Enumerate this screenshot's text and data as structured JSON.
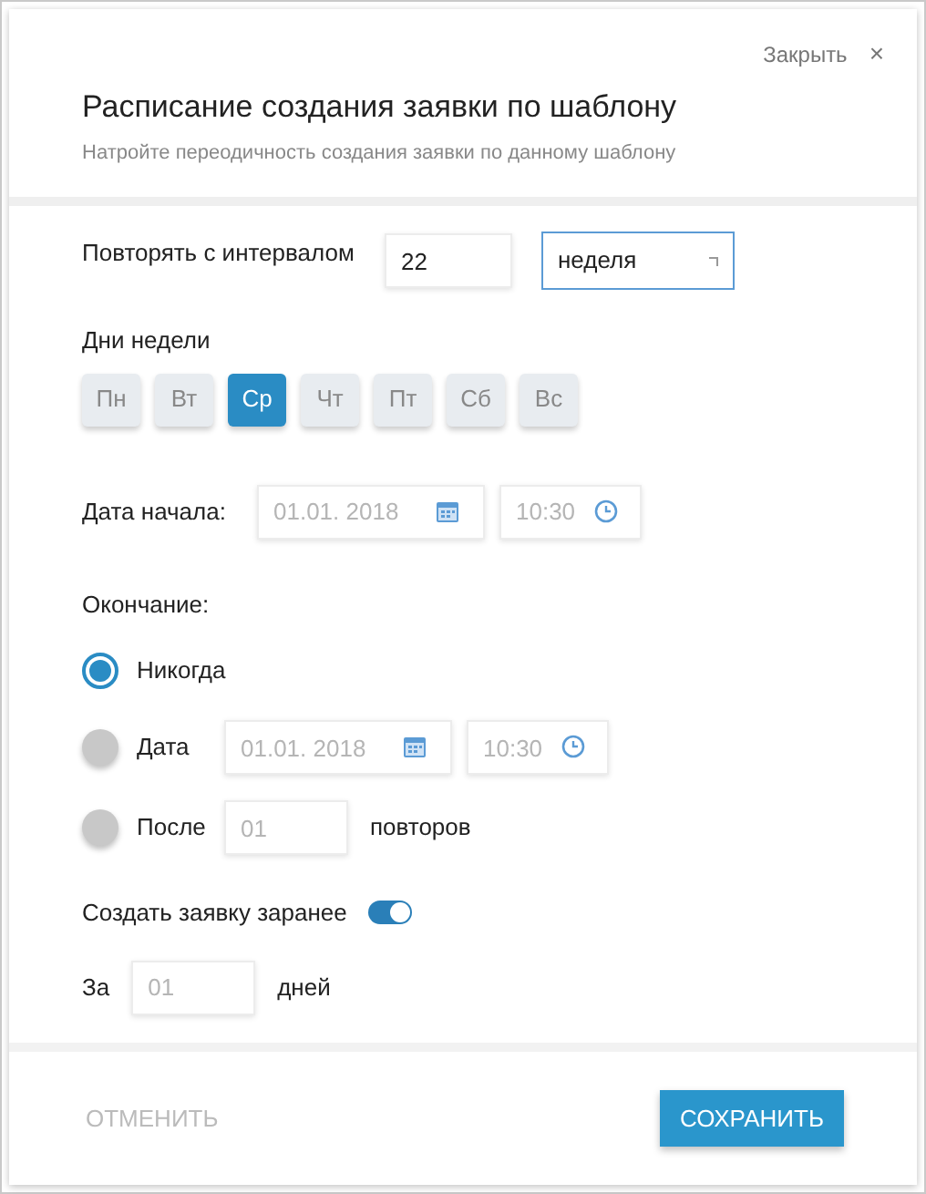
{
  "close_link": {
    "label": "Закрыть",
    "icon": "×"
  },
  "title": "Расписание создания заявки по шаблону",
  "subtitle": "Натройте переодичность создания заявки по данному шаблону",
  "interval": {
    "label": "Повторять с интервалом",
    "value": "22",
    "unit": "неделя"
  },
  "weekdays": {
    "label": "Дни недели",
    "days": [
      {
        "label": "Пн",
        "selected": false
      },
      {
        "label": "Вт",
        "selected": false
      },
      {
        "label": "Ср",
        "selected": true
      },
      {
        "label": "Чт",
        "selected": false
      },
      {
        "label": "Пт",
        "selected": false
      },
      {
        "label": "Сб",
        "selected": false
      },
      {
        "label": "Вс",
        "selected": false
      }
    ]
  },
  "start": {
    "label": "Дата начала:",
    "date_placeholder": "01.01. 2018",
    "time_placeholder": "10:30"
  },
  "end": {
    "label": "Окончание:",
    "options": [
      {
        "kind": "plain",
        "label": "Никогда",
        "selected": true
      },
      {
        "kind": "date",
        "label": "Дата",
        "date_placeholder": "01.01. 2018",
        "time_placeholder": "10:30",
        "selected": false
      },
      {
        "kind": "count",
        "label": "После",
        "placeholder": "01",
        "suffix": "повторов",
        "selected": false
      }
    ]
  },
  "advance": {
    "label": "Создать заявку заранее",
    "on": true,
    "prefix": "За",
    "placeholder": "01",
    "suffix": "дней"
  },
  "buttons": {
    "cancel": "ОТМЕНИТЬ",
    "save": "СОХРАНИТЬ"
  }
}
